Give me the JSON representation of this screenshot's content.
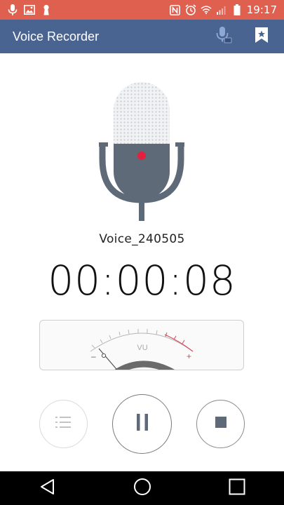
{
  "status_bar": {
    "time": "19:17",
    "left_icons": [
      "mic-icon",
      "image-icon",
      "keyhole-icon"
    ],
    "right_icons": [
      "nfc-icon",
      "alarm-icon",
      "wifi-icon",
      "signal-icon",
      "battery-icon"
    ]
  },
  "app_bar": {
    "title": "Voice Recorder",
    "actions": [
      "voice-memo-icon",
      "bookmark-star-icon"
    ]
  },
  "recording": {
    "file_name": "Voice_240505",
    "elapsed": "00:00:08",
    "state": "recording"
  },
  "vu_meter": {
    "label": "VU",
    "minus_label": "–",
    "plus_label": "+",
    "level": 0.05
  },
  "controls": {
    "list": "list-icon",
    "pause": "pause-icon",
    "stop": "stop-icon"
  },
  "nav": [
    "back-icon",
    "home-icon",
    "recents-icon"
  ],
  "colors": {
    "status_bar": "#e06050",
    "app_bar": "#4a6491",
    "mic_body": "#5f6a78",
    "record_dot": "#e2213f",
    "vu_red": "#d24c5e"
  }
}
